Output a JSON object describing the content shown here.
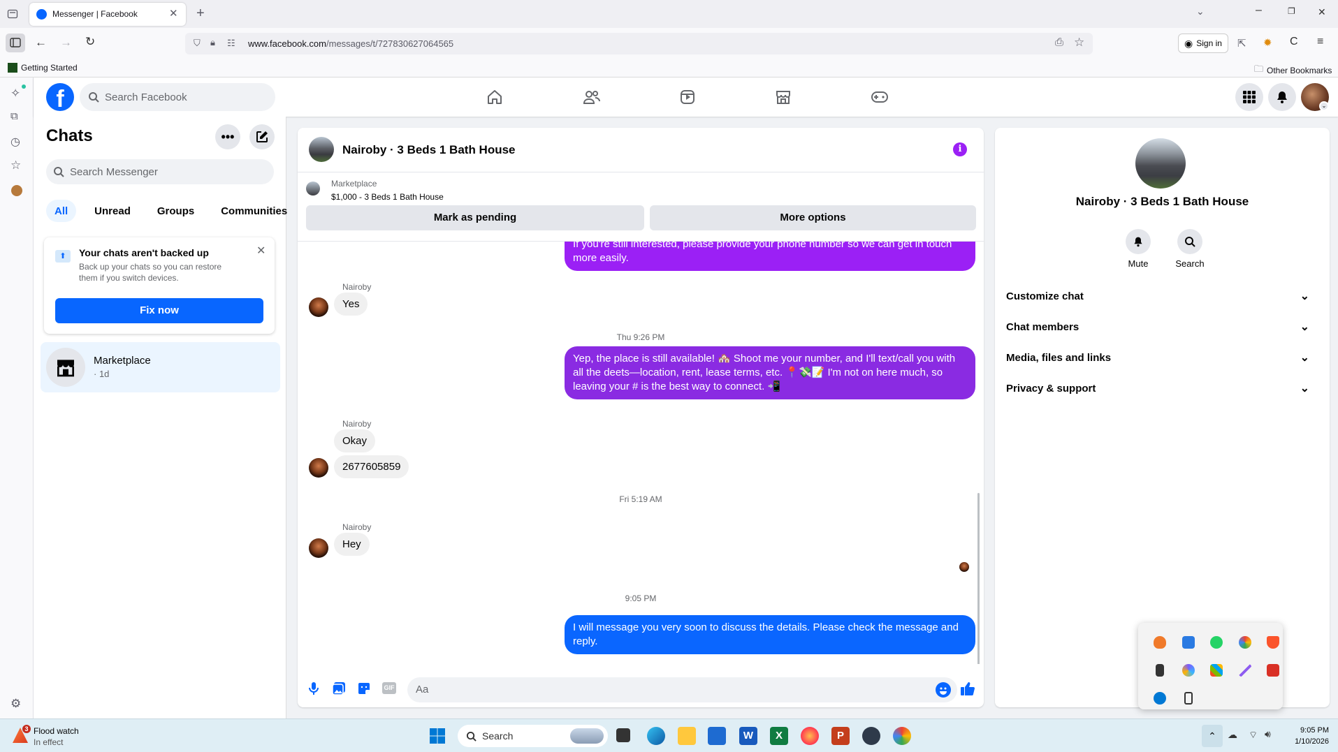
{
  "browser": {
    "tab_title": "Messenger | Facebook",
    "url_domain": "www.facebook.com",
    "url_path": "/messages/t/727830627064565",
    "sign_in": "Sign in",
    "bookmark_getting_started": "Getting Started",
    "bookmark_other": "Other Bookmarks"
  },
  "fb_header": {
    "search_placeholder": "Search Facebook"
  },
  "chats": {
    "title": "Chats",
    "search_placeholder": "Search Messenger",
    "filters": [
      "All",
      "Unread",
      "Groups",
      "Communities"
    ],
    "backup_card": {
      "title": "Your chats aren't backed up",
      "body": "Back up your chats so you can restore them if you switch devices.",
      "button": "Fix now"
    },
    "list": [
      {
        "name": "Marketplace",
        "meta": "· 1d"
      }
    ]
  },
  "conversation": {
    "title": "Nairoby · 3 Beds 1 Bath House",
    "listing_label": "Marketplace",
    "listing_detail": "$1,000 - 3 Beds 1 Bath House",
    "mark_pending": "Mark as pending",
    "more_options": "More options",
    "messages": {
      "out1": "If you're still interested, please provide your phone number so we can get in touch more easily.",
      "sender1": "Nairoby",
      "in1": "Yes",
      "ts1": "Thu 9:26 PM",
      "out2": "Yep, the place is still available! 🏘️ Shoot me your number, and I'll text/call you with all the deets—location, rent, lease terms, etc. 📍💸📝 I'm not on here much, so leaving your # is the best way to connect. 📲",
      "sender2": "Nairoby",
      "in2a": "Okay",
      "in2b": "2677605859",
      "ts2": "Fri 5:19 AM",
      "sender3": "Nairoby",
      "in3": "Hey",
      "ts3": "9:05 PM",
      "out3": "I will message you very soon to discuss the details. Please check the message and reply."
    },
    "composer_placeholder": "Aa"
  },
  "info_panel": {
    "name": "Nairoby · 3 Beds 1 Bath House",
    "mute": "Mute",
    "search": "Search",
    "sections": [
      "Customize chat",
      "Chat members",
      "Media, files and links",
      "Privacy & support"
    ]
  },
  "taskbar": {
    "weather_title": "Flood watch",
    "weather_sub": "In effect",
    "weather_badge": "3",
    "search": "Search",
    "time": "9:05 PM",
    "date": "1/10/2026"
  },
  "colors": {
    "fb_blue": "#0866ff",
    "purple_bubble": "#9b20f5",
    "violet_bubble": "#8a2be2",
    "blue_bubble": "#0a66ff"
  }
}
